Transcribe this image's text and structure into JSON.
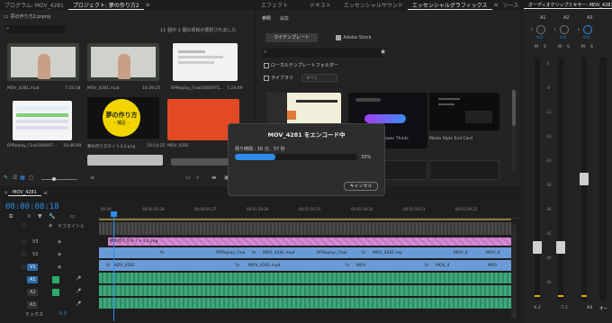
{
  "project_panel": {
    "tabs": [
      "プログラム: MOV_4281",
      "プロジェクト: 夢の作り方2"
    ],
    "project_file": "夢の作り方2.prproj",
    "selection_status": "11 個中 1 個の項目が選択されました",
    "items": [
      {
        "name": "MOV_4281.mp4",
        "duration": "7:33:18"
      },
      {
        "name": "MOV_4281.mp4",
        "duration": "10:29:25"
      },
      {
        "name": "RPReplay_Final1660975...",
        "duration": "7:24:09"
      },
      {
        "name": "RPReplay_Final166097...",
        "duration": "10:46:09"
      },
      {
        "name": "夢の作り方タイトル3.png",
        "duration": "10:14:25"
      },
      {
        "name": "MOV_4281",
        "duration": "10:15:21"
      }
    ],
    "title_card_line1": "夢の作り方",
    "title_card_line2": "- 補足 -"
  },
  "center_panel": {
    "tabs": [
      "エフェクト",
      "テキスト",
      "エッセンシャルサウンド",
      "エッセンシャルグラフィックス",
      "ソース"
    ],
    "subtabs": [
      "参照",
      "編集"
    ],
    "buttons": [
      "マイテンプレート",
      "Adobe Stock"
    ],
    "check_local": "ローカルテンプレートフォルダー",
    "check_library": "ライブラリ",
    "library_select": "すべて",
    "templates": [
      {
        "label": ""
      },
      {
        "label": ""
      },
      {
        "label": "Lower Thirds"
      },
      {
        "label": "Movie Style End Card"
      }
    ]
  },
  "mixer_panel": {
    "title": "オーディオクリップミキサー: MOV_4281",
    "channels": [
      "A1",
      "A2",
      "A3",
      "オー"
    ],
    "ch_labels": [
      "L",
      "L",
      "L"
    ],
    "values": [
      "0.0",
      "0.0",
      "0.0"
    ],
    "mute_solo": [
      "M",
      "S",
      "M",
      "S",
      "M",
      "S"
    ],
    "scale": [
      "0",
      "-6",
      "-12",
      "-18",
      "-24",
      "-30",
      "-36",
      "-42",
      "-48",
      "-54"
    ],
    "bottom": [
      "-6.2",
      "-7.1"
    ]
  },
  "timeline": {
    "sequence_tab": "MOV_4281",
    "timecode": "00:00:08:18",
    "ruler": [
      "00:00",
      "00:00:29:28",
      "00:00:59:27",
      "00:01:29:26",
      "00:01:59:25",
      "00:02:29:24",
      "00:02:59:23",
      "00:03:29:22"
    ],
    "subtitle_track": "サブタイトル",
    "tracks_v": [
      "V3",
      "V2",
      "V1"
    ],
    "tracks_a": [
      "A1",
      "A2",
      "A3"
    ],
    "mix": "ミックス",
    "mix_value": "0.0",
    "clips": {
      "v3": "夢の作り方タイトル3.png",
      "v2": [
        "fx",
        "RPReplay_Fina",
        "fx",
        "MOV_4281.mp4",
        "RPReplay_Final",
        "fx",
        "MOV_4281.mp",
        "MOV_4",
        "MOV_4"
      ],
      "v1": [
        "fx",
        "MOV_4281",
        "fx",
        "MOV_4281.mp4",
        "fx",
        "MOV",
        "fx",
        "MOV_4",
        "MOV"
      ]
    }
  },
  "encode_dialog": {
    "title": "MOV_4281 をエンコード中",
    "remaining": "残り時間 : 16 分、57 秒",
    "percent_label": "33%",
    "progress": 0.33,
    "cancel": "キャンセル"
  },
  "colors": {
    "accent": "#2d8ceb",
    "clip_v2": "#6b9bd6",
    "clip_v3": "#d78bd6",
    "clip_audio": "#3fa77c",
    "playhead": "#2d8ceb"
  }
}
